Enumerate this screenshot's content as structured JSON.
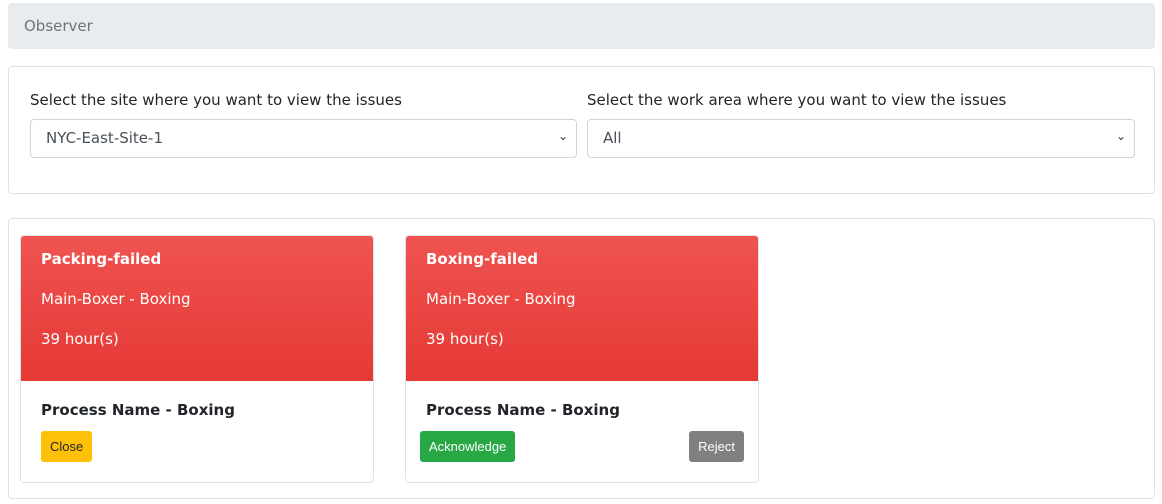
{
  "breadcrumb": "Observer",
  "filters": {
    "site_label": "Select the site where you want to view the issues",
    "site_value": "NYC-East-Site-1",
    "area_label": "Select the work area where you want to view the issues",
    "area_value": "All"
  },
  "colors": {
    "header_red": "#e53935",
    "close": "#ffc107",
    "acknowledge": "#28a745",
    "reject": "#808080"
  },
  "issues": [
    {
      "title": "Packing-failed",
      "location": "Main-Boxer - Boxing",
      "duration": "39 hour(s)",
      "process": "Process Name - Boxing",
      "close_label": "Close"
    },
    {
      "title": "Boxing-failed",
      "location": "Main-Boxer - Boxing",
      "duration": "39 hour(s)",
      "process": "Process Name - Boxing",
      "ack_label": "Acknowledge",
      "reject_label": "Reject"
    }
  ]
}
